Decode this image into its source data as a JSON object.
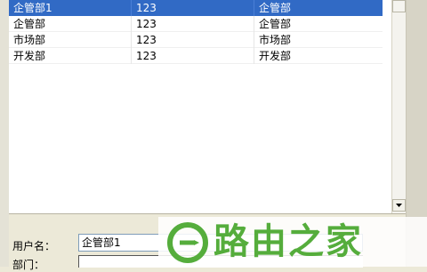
{
  "list": {
    "rows": [
      {
        "col1": "企管部1",
        "col2": "123",
        "col3": "企管部",
        "selected": true
      },
      {
        "col1": "企管部",
        "col2": "123",
        "col3": "企管部",
        "selected": false
      },
      {
        "col1": "市场部",
        "col2": "123",
        "col3": "市场部",
        "selected": false
      },
      {
        "col1": "开发部",
        "col2": "123",
        "col3": "开发部",
        "selected": false
      }
    ]
  },
  "form": {
    "username_label": "用户名：",
    "username_value": "企管部1",
    "dept_label": "部门："
  },
  "watermark": {
    "text": "路由之家",
    "color": "#55ad3c"
  },
  "colors": {
    "selection": "#316ac5",
    "window_bg": "#ece9d8"
  }
}
